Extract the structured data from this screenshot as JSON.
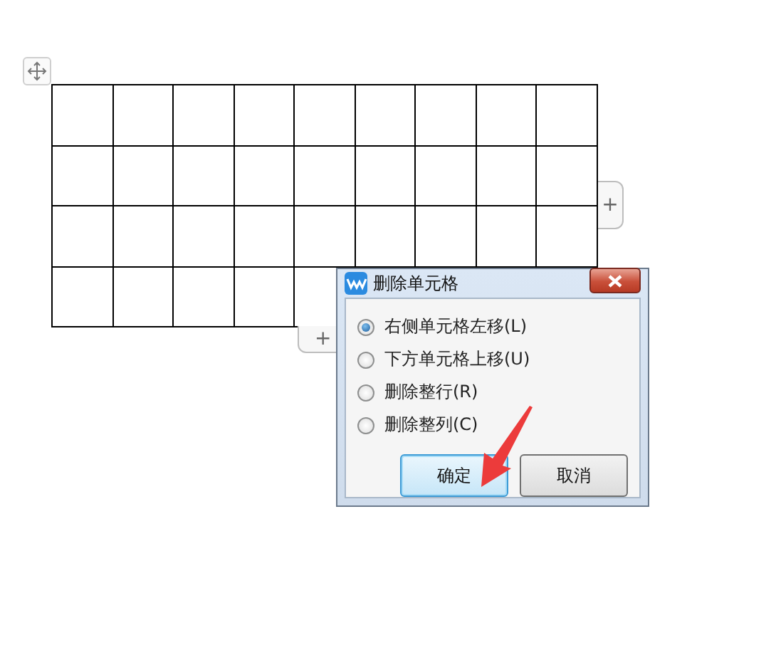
{
  "add_column_button": {
    "label": "+"
  },
  "add_row_button": {
    "label": "+"
  },
  "dialog": {
    "title": "删除单元格",
    "options": [
      {
        "label": "右侧单元格左移(L)",
        "selected": true
      },
      {
        "label": "下方单元格上移(U)",
        "selected": false
      },
      {
        "label": "删除整行(R)",
        "selected": false
      },
      {
        "label": "删除整列(C)",
        "selected": false
      }
    ],
    "buttons": [
      {
        "label": "确定",
        "focused": true
      },
      {
        "label": "取消",
        "focused": false
      }
    ]
  }
}
